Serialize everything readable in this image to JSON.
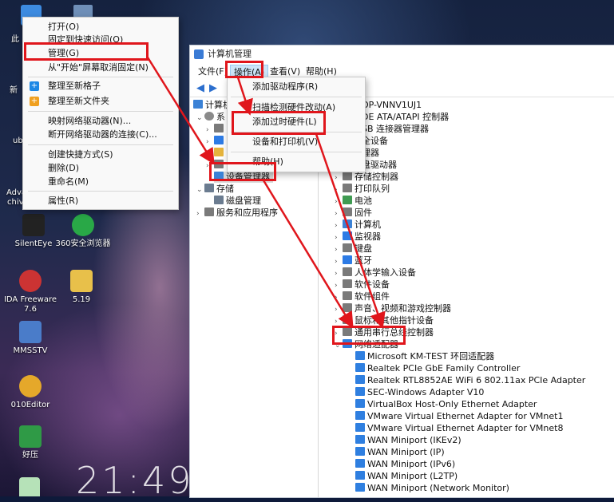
{
  "desktop": {
    "clock": "21:49",
    "icons": [
      {
        "label": "SilentEye",
        "icon": "silenteye-icon"
      },
      {
        "label": "360安全浏览器",
        "icon": "browser-360-icon"
      },
      {
        "label": "IDA Freeware 7.6",
        "icon": "ida-icon"
      },
      {
        "label": "5.19",
        "icon": "folder-icon"
      },
      {
        "label": "MMSSTV",
        "icon": "mmsstv-icon"
      },
      {
        "label": "010Editor",
        "icon": "010editor-icon"
      },
      {
        "label": "好压",
        "icon": "haozip-icon"
      }
    ],
    "partial_labels": [
      "此",
      "新",
      "ub",
      "Adva",
      "chiv"
    ]
  },
  "context_menu": {
    "items": [
      {
        "label": "打开(O)"
      },
      {
        "label": "固定到快速访问(O)"
      },
      {
        "label": "管理(G)"
      },
      {
        "label": "从\"开始\"屏幕取消固定(N)"
      },
      {
        "label": "整理至新格子",
        "icon": "plus-icon"
      },
      {
        "label": "整理至新文件夹",
        "icon": "plus-icon"
      },
      {
        "label": "映射网络驱动器(N)..."
      },
      {
        "label": "断开网络驱动器的连接(C)..."
      },
      {
        "label": "创建快捷方式(S)"
      },
      {
        "label": "删除(D)"
      },
      {
        "label": "重命名(M)"
      },
      {
        "label": "属性(R)"
      }
    ]
  },
  "window": {
    "title": "计算机管理",
    "menu": [
      "文件(F)",
      "操作(A)",
      "查看(V)",
      "帮助(H)"
    ],
    "action_menu": [
      "添加驱动程序(R)",
      "扫描检测硬件改动(A)",
      "添加过时硬件(L)",
      "设备和打印机(V)",
      "帮助(H)"
    ],
    "left_tree": {
      "root": "计算机",
      "system": "系",
      "device_manager": "设备管理器",
      "storage": "存储",
      "disk_management": "磁盘管理",
      "services": "服务和应用程序"
    },
    "right_tree": {
      "computer_name": "OP-VNNV1UJ1",
      "categories": [
        "DE ATA/ATAPI 控制器",
        "SB 连接器管理器",
        "全设备",
        "理器",
        "盘驱动器",
        "存储控制器",
        "打印队列",
        "电池",
        "固件",
        "计算机",
        "监视器",
        "键盘",
        "蓝牙",
        "人体学输入设备",
        "软件设备",
        "软件组件",
        "声音、视频和游戏控制器",
        "鼠标和其他指针设备",
        "通用串行总线控制器",
        "网络适配器"
      ],
      "network_adapters": [
        "Microsoft KM-TEST 环回适配器",
        "Realtek PCIe GbE Family Controller",
        "Realtek RTL8852AE WiFi 6 802.11ax PCIe Adapter",
        "SEC-Windows Adapter V10",
        "VirtualBox Host-Only Ethernet Adapter",
        "VMware Virtual Ethernet Adapter for VMnet1",
        "VMware Virtual Ethernet Adapter for VMnet8",
        "WAN Miniport (IKEv2)",
        "WAN Miniport (IP)",
        "WAN Miniport (IPv6)",
        "WAN Miniport (L2TP)",
        "WAN Miniport (Network Monitor)"
      ]
    }
  },
  "annotation_color": "#e0161c"
}
